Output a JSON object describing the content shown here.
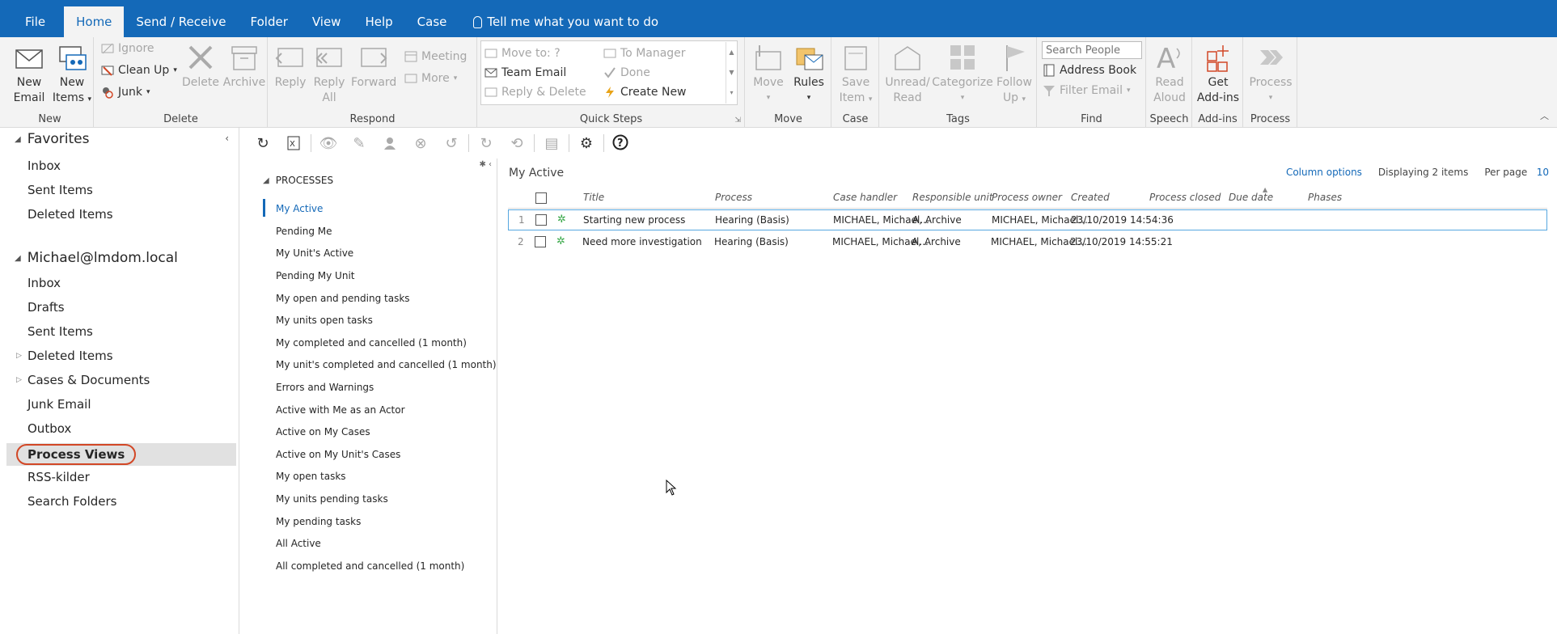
{
  "menu": {
    "tabs": [
      "File",
      "Home",
      "Send / Receive",
      "Folder",
      "View",
      "Help",
      "Case"
    ],
    "tell_me": "Tell me what you want to do"
  },
  "ribbon": {
    "new": {
      "label": "New",
      "new_email_1": "New",
      "new_email_2": "Email",
      "new_items_1": "New",
      "new_items_2": "Items"
    },
    "delete": {
      "label": "Delete",
      "ignore": "Ignore",
      "clean_up": "Clean Up",
      "junk": "Junk",
      "delete": "Delete",
      "archive": "Archive"
    },
    "respond": {
      "label": "Respond",
      "reply": "Reply",
      "reply_all_1": "Reply",
      "reply_all_2": "All",
      "forward": "Forward",
      "meeting": "Meeting",
      "more": "More"
    },
    "quick_steps": {
      "label": "Quick Steps",
      "move_to": "Move to: ?",
      "team_email": "Team Email",
      "reply_delete": "Reply & Delete",
      "to_manager": "To Manager",
      "done": "Done",
      "create_new": "Create New"
    },
    "move": {
      "label": "Move",
      "move": "Move",
      "rules": "Rules"
    },
    "case": {
      "label": "Case",
      "save_item_1": "Save",
      "save_item_2": "Item"
    },
    "tags": {
      "label": "Tags",
      "unread_1": "Unread/",
      "unread_2": "Read",
      "categorize": "Categorize",
      "follow_up_1": "Follow",
      "follow_up_2": "Up"
    },
    "find": {
      "label": "Find",
      "search_people_placeholder": "Search People",
      "address_book": "Address Book",
      "filter_email": "Filter Email"
    },
    "speech": {
      "label": "Speech",
      "read_aloud_1": "Read",
      "read_aloud_2": "Aloud"
    },
    "addins": {
      "label": "Add-ins",
      "get_addins_1": "Get",
      "get_addins_2": "Add-ins"
    },
    "process": {
      "label": "Process",
      "process": "Process"
    }
  },
  "folders": {
    "favorites_header": "Favorites",
    "favorites": [
      "Inbox",
      "Sent Items",
      "Deleted Items"
    ],
    "account_header": "Michael@lmdom.local",
    "account_items": [
      "Inbox",
      "Drafts",
      "Sent Items",
      "Deleted Items",
      "Cases & Documents",
      "Junk Email",
      "Outbox",
      "Process Views",
      "RSS-kilder",
      "Search Folders"
    ]
  },
  "processes": {
    "header": "PROCESSES",
    "items": [
      "My Active",
      "Pending Me",
      "My Unit's Active",
      "Pending My Unit",
      "My open and pending tasks",
      "My units open tasks",
      "My completed and cancelled (1 month)",
      "My unit's completed and cancelled (1 month)",
      "Errors and Warnings",
      "Active with Me as an Actor",
      "Active on My Cases",
      "Active on My Unit's Cases",
      "My open tasks",
      "My units pending tasks",
      "My pending tasks",
      "All Active",
      "All completed and cancelled (1 month)"
    ]
  },
  "grid": {
    "title": "My Active",
    "column_options": "Column options",
    "displaying": "Displaying 2 items",
    "per_page_label": "Per page",
    "per_page_value": "10",
    "columns": [
      "Title",
      "Process",
      "Case handler",
      "Responsible unit",
      "Process owner",
      "Created",
      "Process closed",
      "Due date",
      "Phases"
    ],
    "rows": [
      {
        "num": "1",
        "title": "Starting new process",
        "process": "Hearing (Basis)",
        "case_handler": "MICHAEL, Michael...",
        "unit": "A, Archive",
        "owner": "MICHAEL, Michael...",
        "created": "23/10/2019 14:54:36"
      },
      {
        "num": "2",
        "title": "Need more investigation",
        "process": "Hearing (Basis)",
        "case_handler": "MICHAEL, Michael...",
        "unit": "A, Archive",
        "owner": "MICHAEL, Michael...",
        "created": "23/10/2019 14:55:21"
      }
    ]
  }
}
